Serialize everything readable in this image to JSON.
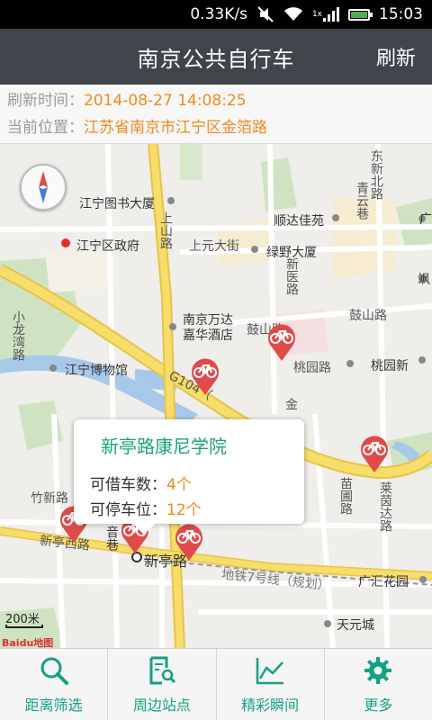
{
  "status_bar": {
    "speed": "0.33K/s",
    "network": "1x",
    "time": "15:03",
    "battery_level": 0.9
  },
  "header": {
    "title": "南京公共自行车",
    "refresh_label": "刷新"
  },
  "info": {
    "refresh_time_label": "刷新时间：",
    "refresh_time_value": "2014-08-27 14:08:25",
    "location_label": "当前位置：",
    "location_value": "江苏省南京市江宁区金箔路"
  },
  "map": {
    "labels": {
      "library": "江宁图书大厦",
      "gov": "江宁区政府",
      "shangshan_road": "上山路",
      "shangyuan": "上元大街",
      "shundajia": "顺达佳苑",
      "lvye": "绿野大厦",
      "dongxin_north": "东新北路",
      "qingyun": "青云巷",
      "guang_cut": "广",
      "feng_cut": "飒",
      "xinyi_road": "新医路",
      "wanda": "南京万达嘉华酒店",
      "gushan_road": "鼓山路",
      "gushan_road_2": "鼓山路",
      "taoyuan_road": "桃园路",
      "taoyuan_new": "桃园新",
      "xiaolong_road": "小龙湾路",
      "museum": "江宁博物馆",
      "g104": "G104（",
      "jin_cut": "金",
      "zhuxin_road": "竹新路",
      "miaoyun_road": "苗圃路",
      "laiyan_road": "莱茵达路",
      "xinting_west": "新亭西路",
      "yinxiang": "音巷",
      "xinting_road": "新亭路",
      "metro": "地铁7号线（规划）",
      "guanghui": "广汇花园",
      "tianyuan": "天元城",
      "scale": "200米",
      "baidu": "Baidu地图"
    },
    "popup": {
      "title": "新亭路康尼学院",
      "borrow_label": "可借车数：",
      "borrow_value": "4个",
      "park_label": "可停车位：",
      "park_value": "12个"
    }
  },
  "nav": {
    "items": [
      {
        "label": "距离筛选",
        "icon": "search-icon"
      },
      {
        "label": "周边站点",
        "icon": "document-search-icon"
      },
      {
        "label": "精彩瞬间",
        "icon": "line-chart-icon"
      },
      {
        "label": "更多",
        "icon": "gear-icon"
      }
    ]
  },
  "colors": {
    "accent": "#13a184",
    "orange": "#f08a1e",
    "titlebar": "#3f454a",
    "pin": "#e14a4a"
  }
}
